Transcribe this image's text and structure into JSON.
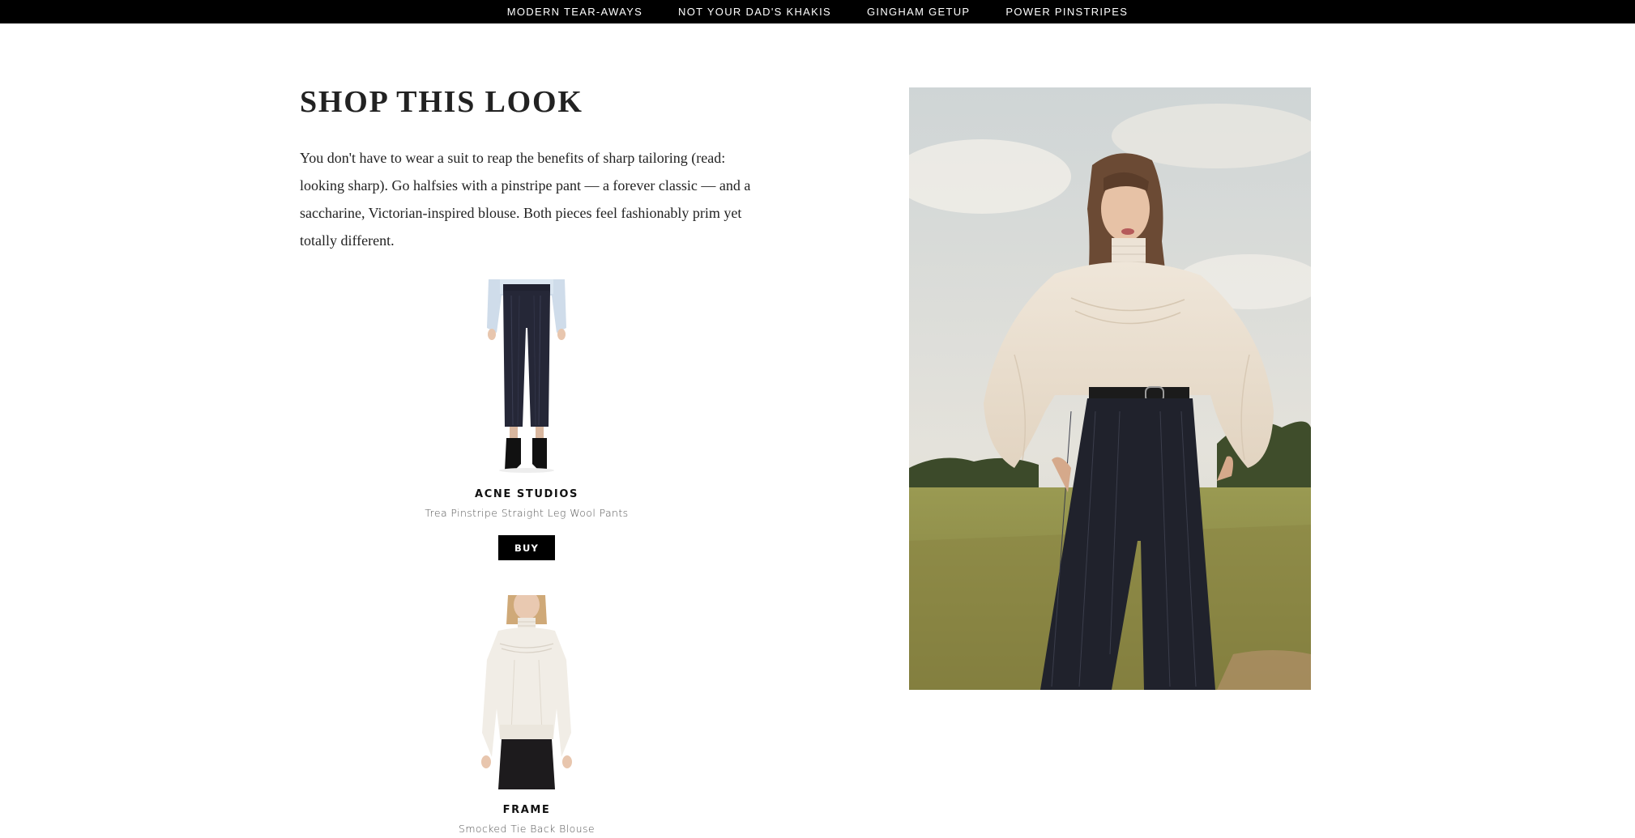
{
  "nav": {
    "items": [
      "MODERN TEAR-AWAYS",
      "NOT YOUR DAD'S KHAKIS",
      "GINGHAM GETUP",
      "POWER PINSTRIPES"
    ]
  },
  "section": {
    "title": "SHOP THIS LOOK",
    "description": "You don't have to wear a suit to reap the benefits of sharp tailoring (read: looking sharp). Go halfsies with a pinstripe pant — a forever classic — and a saccharine, Victorian-inspired blouse. Both pieces feel fashionably prim yet totally different."
  },
  "products": [
    {
      "brand": "ACNE STUDIOS",
      "name": "Trea Pinstripe Straight Leg Wool Pants",
      "cta": "BUY"
    },
    {
      "brand": "FRAME",
      "name": "Smocked Tie Back Blouse"
    }
  ],
  "colors": {
    "nav_bg": "#000000",
    "button_bg": "#000000",
    "text": "#222222"
  }
}
